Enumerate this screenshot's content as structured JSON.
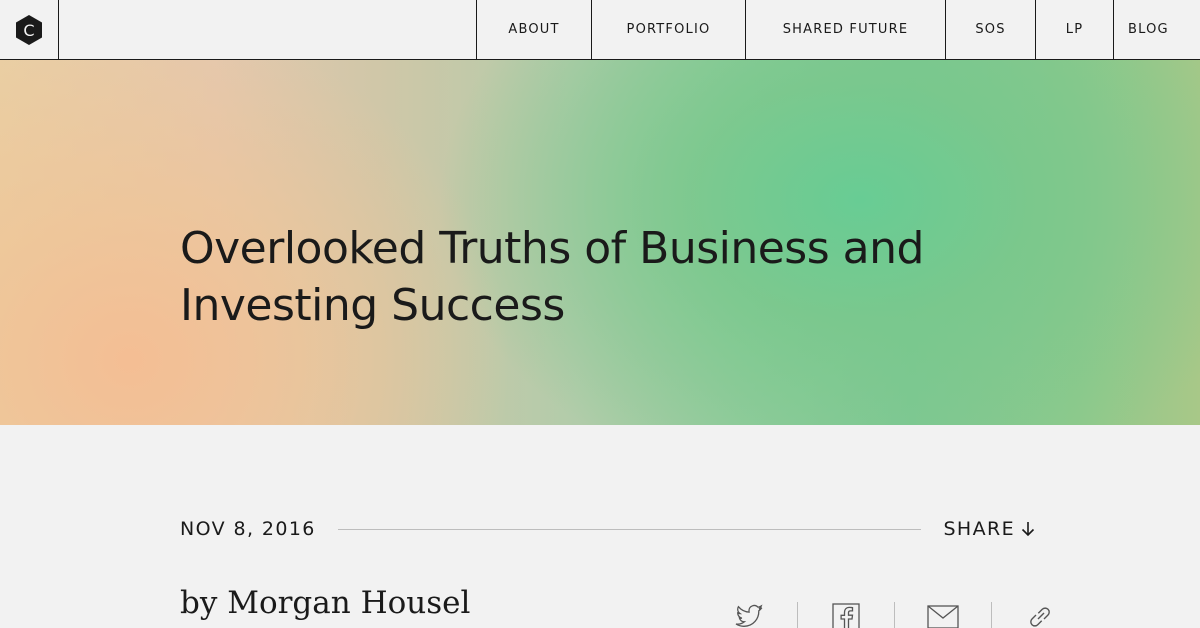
{
  "header": {
    "logo_letter": "C",
    "nav": [
      {
        "label": "ABOUT"
      },
      {
        "label": "PORTFOLIO"
      },
      {
        "label": "SHARED FUTURE"
      },
      {
        "label": "SOS"
      },
      {
        "label": "LP"
      },
      {
        "label": "BLOG"
      }
    ]
  },
  "hero": {
    "title": "Overlooked Truths of Business and Investing Success"
  },
  "post": {
    "date": "NOV 8, 2016",
    "share_label": "SHARE",
    "byline": "by Morgan Housel",
    "share_icons": [
      "twitter-icon",
      "facebook-icon",
      "email-icon",
      "link-icon"
    ]
  },
  "colors": {
    "text": "#1a1a1a",
    "background": "#f2f2f2",
    "rule": "#bdbdbd",
    "hero_green": "#68cc94",
    "hero_peach": "#f4be94"
  }
}
